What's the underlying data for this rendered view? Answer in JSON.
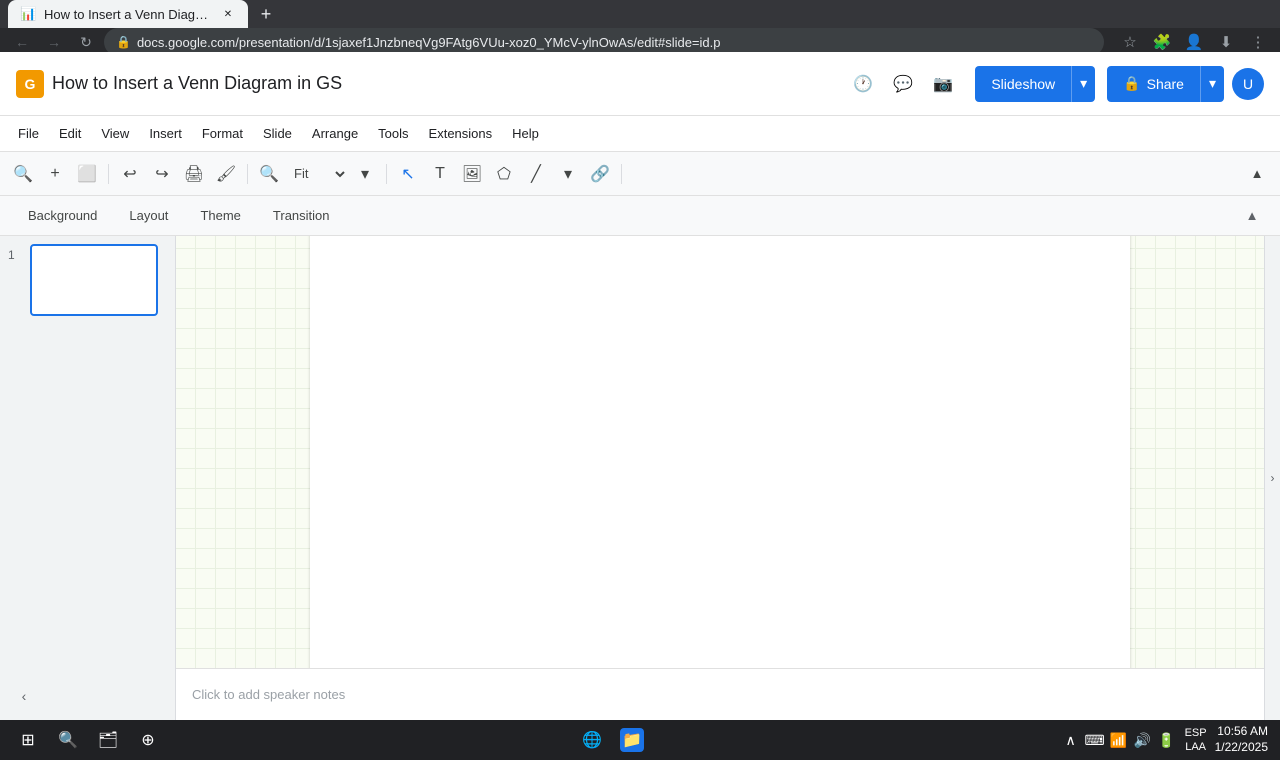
{
  "browser": {
    "tabs": [
      {
        "id": "tab1",
        "title": "How to Insert a Venn Diagram",
        "favicon": "📊",
        "active": true
      }
    ],
    "new_tab_label": "+",
    "address": "docs.google.com/presentation/d/1sjaxef1JnzbneqVg9FAtg6VUu-xoz0_YMcV-ylnOwAs/edit#slide=id.p",
    "nav": {
      "back": "←",
      "forward": "→",
      "refresh": "↻"
    }
  },
  "app": {
    "logo_letter": "G",
    "title": "How to Insert a Venn Diagram in GS",
    "slideshow_label": "Slideshow",
    "slideshow_dropdown": "▾",
    "share_label": "Share",
    "share_dropdown": "▾",
    "avatar_letter": "U"
  },
  "menu": {
    "items": [
      "File",
      "Edit",
      "View",
      "Insert",
      "Format",
      "Slide",
      "Arrange",
      "Tools",
      "Extensions",
      "Help"
    ]
  },
  "toolbar": {
    "search_tooltip": "Search",
    "zoom_value": "Fit",
    "fit_dropdown": "▾",
    "collapse_label": "▲"
  },
  "slide_toolbar": {
    "background_label": "Background",
    "layout_label": "Layout",
    "theme_label": "Theme",
    "transition_label": "Transition"
  },
  "slides": [
    {
      "number": "1",
      "selected": true
    }
  ],
  "notes": {
    "placeholder": "Click to add speaker notes"
  },
  "statusbar": {
    "time": "10:56 AM\n1/22/2025",
    "language": "ESP\nLAA"
  },
  "taskbar": {
    "start_icon": "⊞",
    "search_icon": "🔍",
    "files_icon": "📁",
    "apps_icon": "⊕",
    "chrome_icon": "⊙",
    "explorer_icon": "📂"
  }
}
